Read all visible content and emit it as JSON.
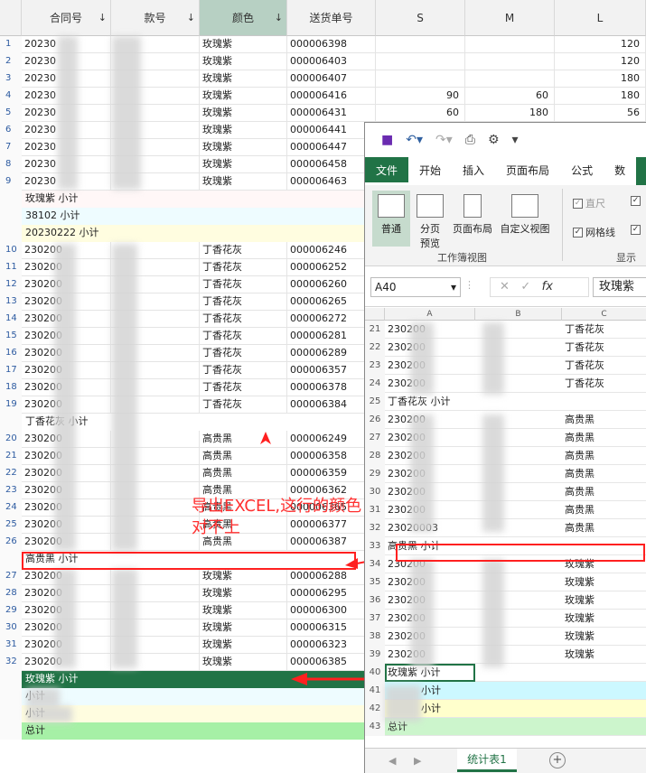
{
  "left_table": {
    "headers": {
      "contract_no": "合同号",
      "style_no": "款号",
      "color": "颜色",
      "delivery_no": "送货单号",
      "size_s": "S",
      "size_m": "M",
      "size_l": "L"
    },
    "rows": [
      {
        "n": "1",
        "contract": "20230",
        "color": "玫瑰紫",
        "delivery": "000006398",
        "s": "",
        "m": "",
        "l": "120"
      },
      {
        "n": "2",
        "contract": "20230",
        "color": "玫瑰紫",
        "delivery": "000006403",
        "s": "",
        "m": "",
        "l": "120"
      },
      {
        "n": "3",
        "contract": "20230",
        "color": "玫瑰紫",
        "delivery": "000006407",
        "s": "",
        "m": "",
        "l": "180"
      },
      {
        "n": "4",
        "contract": "20230",
        "color": "玫瑰紫",
        "delivery": "000006416",
        "s": "90",
        "m": "60",
        "l": "180"
      },
      {
        "n": "5",
        "contract": "20230",
        "color": "玫瑰紫",
        "delivery": "000006431",
        "s": "60",
        "m": "180",
        "l": "56"
      },
      {
        "n": "6",
        "contract": "20230",
        "color": "玫瑰紫",
        "delivery": "000006441",
        "s": "",
        "m": "",
        "l": ""
      },
      {
        "n": "7",
        "contract": "20230",
        "color": "玫瑰紫",
        "delivery": "000006447",
        "s": "",
        "m": "",
        "l": ""
      },
      {
        "n": "8",
        "contract": "20230",
        "color": "玫瑰紫",
        "delivery": "000006458",
        "s": "",
        "m": "",
        "l": ""
      },
      {
        "n": "9",
        "contract": "20230",
        "color": "玫瑰紫",
        "delivery": "000006463",
        "s": "",
        "m": "",
        "l": ""
      }
    ],
    "sub1": "玫瑰紫 小计",
    "sub2": "38102 小计",
    "sub3": "20230222 小计",
    "rows2": [
      {
        "n": "10",
        "contract": "230200",
        "color": "丁香花灰",
        "delivery": "000006246"
      },
      {
        "n": "11",
        "contract": "230200",
        "color": "丁香花灰",
        "delivery": "000006252"
      },
      {
        "n": "12",
        "contract": "230200",
        "color": "丁香花灰",
        "delivery": "000006260"
      },
      {
        "n": "13",
        "contract": "230200",
        "color": "丁香花灰",
        "delivery": "000006265"
      },
      {
        "n": "14",
        "contract": "230200",
        "color": "丁香花灰",
        "delivery": "000006272"
      },
      {
        "n": "15",
        "contract": "230200",
        "color": "丁香花灰",
        "delivery": "000006281"
      },
      {
        "n": "16",
        "contract": "230200",
        "color": "丁香花灰",
        "delivery": "000006289"
      },
      {
        "n": "17",
        "contract": "230200",
        "color": "丁香花灰",
        "delivery": "000006357"
      },
      {
        "n": "18",
        "contract": "230200",
        "color": "丁香花灰",
        "delivery": "000006378"
      },
      {
        "n": "19",
        "contract": "230200",
        "color": "丁香花灰",
        "delivery": "000006384"
      }
    ],
    "sub4": "丁香花灰 小计",
    "rows3": [
      {
        "n": "20",
        "contract": "230200",
        "color": "高贵黑",
        "delivery": "000006249"
      },
      {
        "n": "21",
        "contract": "230200",
        "color": "高贵黑",
        "delivery": "000006358"
      },
      {
        "n": "22",
        "contract": "230200",
        "color": "高贵黑",
        "delivery": "000006359"
      },
      {
        "n": "23",
        "contract": "230200",
        "color": "高贵黑",
        "delivery": "000006362"
      },
      {
        "n": "24",
        "contract": "230200",
        "color": "高贵黑",
        "delivery": "000006365"
      },
      {
        "n": "25",
        "contract": "230200",
        "color": "高贵黑",
        "delivery": "000006377"
      },
      {
        "n": "26",
        "contract": "230200",
        "color": "高贵黑",
        "delivery": "000006387"
      }
    ],
    "sub5": "高贵黑 小计",
    "rows4": [
      {
        "n": "27",
        "contract": "230200",
        "color": "玫瑰紫",
        "delivery": "000006288"
      },
      {
        "n": "28",
        "contract": "230200",
        "color": "玫瑰紫",
        "delivery": "000006295"
      },
      {
        "n": "29",
        "contract": "230200",
        "color": "玫瑰紫",
        "delivery": "000006300"
      },
      {
        "n": "30",
        "contract": "230200",
        "color": "玫瑰紫",
        "delivery": "000006315"
      },
      {
        "n": "31",
        "contract": "230200",
        "color": "玫瑰紫",
        "delivery": "000006323"
      },
      {
        "n": "32",
        "contract": "230200",
        "color": "玫瑰紫",
        "delivery": "000006385"
      }
    ],
    "sub6": "玫瑰紫 小计",
    "sub7": "小计",
    "sub8": "小计",
    "total": "总计"
  },
  "annotation": {
    "line1": "导出EXCEL,这行的颜色",
    "line2": "对不上"
  },
  "excel": {
    "tabs": [
      "文件",
      "开始",
      "插入",
      "页面布局",
      "公式",
      "数"
    ],
    "ribbon": {
      "normal": "普通",
      "page_break": "分页",
      "page_break2": "预览",
      "page_layout": "页面布局",
      "custom_view": "自定义视图",
      "group_label": "工作簿视图",
      "ruler": "直尺",
      "gridlines": "网格线",
      "show_label": "显示"
    },
    "name_box": "A40",
    "formula_value": "玫瑰紫",
    "fx": "fx",
    "cols": [
      "A",
      "B",
      "C"
    ],
    "rows": [
      {
        "n": "21",
        "a": "230200",
        "c": "丁香花灰"
      },
      {
        "n": "22",
        "a": "230200",
        "c": "丁香花灰"
      },
      {
        "n": "23",
        "a": "230200",
        "c": "丁香花灰"
      },
      {
        "n": "24",
        "a": "230200",
        "c": "丁香花灰"
      },
      {
        "n": "25",
        "a": "丁香花灰 小计",
        "c": ""
      },
      {
        "n": "26",
        "a": "230200",
        "c": "高贵黑"
      },
      {
        "n": "27",
        "a": "230200",
        "c": "高贵黑"
      },
      {
        "n": "28",
        "a": "230200",
        "c": "高贵黑"
      },
      {
        "n": "29",
        "a": "230200",
        "c": "高贵黑"
      },
      {
        "n": "30",
        "a": "230200",
        "c": "高贵黑"
      },
      {
        "n": "31",
        "a": "230200",
        "c": "高贵黑"
      },
      {
        "n": "32",
        "a": "23020003",
        "c": "高贵黑"
      },
      {
        "n": "33",
        "a": "高贵黑 小计",
        "c": ""
      },
      {
        "n": "34",
        "a": "230200",
        "c": "玫瑰紫"
      },
      {
        "n": "35",
        "a": "230200",
        "c": "玫瑰紫"
      },
      {
        "n": "36",
        "a": "230200",
        "c": "玫瑰紫"
      },
      {
        "n": "37",
        "a": "230200",
        "c": "玫瑰紫"
      },
      {
        "n": "38",
        "a": "230200",
        "c": "玫瑰紫"
      },
      {
        "n": "39",
        "a": "230200",
        "c": "玫瑰紫"
      },
      {
        "n": "40",
        "a": "玫瑰紫 小计",
        "c": ""
      },
      {
        "n": "41",
        "a": "小计",
        "c": ""
      },
      {
        "n": "42",
        "a": "小计",
        "c": ""
      },
      {
        "n": "43",
        "a": "总计",
        "c": ""
      }
    ],
    "sheet_tab": "统计表1",
    "add_sheet": "+"
  },
  "colors": {
    "header_selected": "#b7d0c3",
    "sub_yellow": "#fffde0",
    "sub_cyan": "#eefcff",
    "total_green": "#a6f0a6",
    "selected_row": "#217346",
    "excel_green": "#217346",
    "annotation_red": "#ff2020"
  }
}
